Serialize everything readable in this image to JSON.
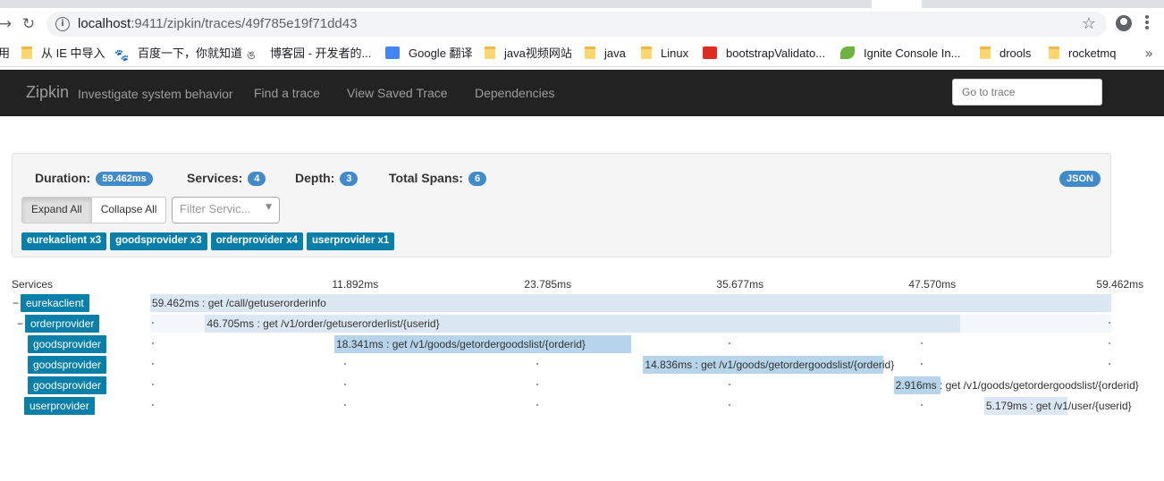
{
  "browser": {
    "url_host": "localhost",
    "url_path": ":9411/zipkin/traces/49f785e19f71dd43",
    "bookmarks": [
      {
        "label": "从 IE 中导入",
        "icon": "folder-icon"
      },
      {
        "label": "百度一下，你就知道",
        "icon": "paw-icon"
      },
      {
        "label": "博客园 - 开发者的...",
        "icon": "blog-icon"
      },
      {
        "label": "Google 翻译",
        "icon": "google-translate-icon"
      },
      {
        "label": "java视频网站",
        "icon": "folder-icon"
      },
      {
        "label": "java",
        "icon": "folder-icon"
      },
      {
        "label": "Linux",
        "icon": "folder-icon"
      },
      {
        "label": "bootstrapValidato...",
        "icon": "red-c-icon"
      },
      {
        "label": "Ignite Console In...",
        "icon": "leaf-icon"
      },
      {
        "label": "drools",
        "icon": "folder-icon"
      },
      {
        "label": "rocketmq",
        "icon": "folder-icon"
      }
    ],
    "bookmarks_prefix": "用"
  },
  "navbar": {
    "brand": "Zipkin",
    "tagline": "Investigate system behavior",
    "links": [
      "Find a trace",
      "View Saved Trace",
      "Dependencies"
    ],
    "goto_placeholder": "Go to trace"
  },
  "summary": {
    "duration_label": "Duration:",
    "duration_value": "59.462ms",
    "services_label": "Services:",
    "services_value": "4",
    "depth_label": "Depth:",
    "depth_value": "3",
    "spans_label": "Total Spans:",
    "spans_value": "6",
    "json_label": "JSON",
    "expand_label": "Expand All",
    "collapse_label": "Collapse All",
    "filter_placeholder": "Filter Servic...",
    "service_tags": [
      "eurekaclient x3",
      "goodsprovider x3",
      "orderprovider x4",
      "userprovider x1"
    ]
  },
  "timeline": {
    "services_header": "Services",
    "tick_labels": [
      "11.892ms",
      "23.785ms",
      "35.677ms",
      "47.570ms",
      "59.462ms"
    ],
    "rows": [
      {
        "toggle": "−",
        "service": "eurekaclient",
        "span_text": "59.462ms : get /call/getuserorderinfo"
      },
      {
        "toggle": "−",
        "service": "orderprovider",
        "span_text": "46.705ms : get /v1/order/getuserorderlist/{userid}"
      },
      {
        "toggle": "",
        "service": "goodsprovider",
        "span_text": "18.341ms : get /v1/goods/getordergoodslist/{orderid}"
      },
      {
        "toggle": "",
        "service": "goodsprovider",
        "span_text": "14.836ms : get /v1/goods/getordergoodslist/{orderid}"
      },
      {
        "toggle": "",
        "service": "goodsprovider",
        "span_text": "2.916ms : get /v1/goods/getordergoodslist/{orderid}"
      },
      {
        "toggle": "",
        "service": "userprovider",
        "span_text": "5.179ms : get /v1/user/{userid}"
      }
    ]
  },
  "chart_data": {
    "type": "bar",
    "title": "",
    "xlabel": "",
    "ylabel": "Services",
    "xlim": [
      0,
      59.462
    ],
    "x_ticks": [
      11.892,
      23.785,
      35.677,
      47.57,
      59.462
    ],
    "categories": [
      "eurekaclient",
      "orderprovider",
      "goodsprovider",
      "goodsprovider",
      "goodsprovider",
      "userprovider"
    ],
    "series": [
      {
        "values": [
          59.462,
          46.705,
          18.341,
          14.836,
          2.916,
          5.179
        ]
      }
    ],
    "start_ms": [
      0,
      3.4,
      11.4,
      30.5,
      46.0,
      51.6
    ]
  }
}
